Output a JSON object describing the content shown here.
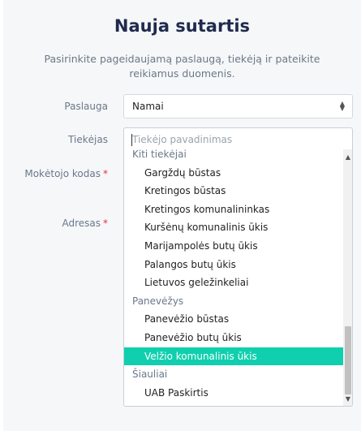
{
  "form": {
    "title": "Nauja sutartis",
    "subtitle": "Pasirinkite pageidaujamą paslaugą, tiekėją ir pateikite reikiamus duomenis.",
    "required_mark": "*",
    "fields": {
      "service_label": "Paslauga",
      "service_value": "Namai",
      "provider_label": "Tiekėjas",
      "provider_placeholder": "Tiekėjo pavadinimas",
      "payer_code_label": "Mokėtojo kodas",
      "address_label": "Adresas"
    }
  },
  "dropdown": {
    "items": [
      {
        "type": "group",
        "label": "Kiti tiekėjai"
      },
      {
        "type": "option",
        "label": "Gargždų būstas"
      },
      {
        "type": "option",
        "label": "Kretingos būstas"
      },
      {
        "type": "option",
        "label": "Kretingos komunalininkas"
      },
      {
        "type": "option",
        "label": "Kuršėnų komunalinis ūkis"
      },
      {
        "type": "option",
        "label": "Marijampolės butų ūkis"
      },
      {
        "type": "option",
        "label": "Palangos butų ūkis"
      },
      {
        "type": "option",
        "label": "Lietuvos geležinkeliai"
      },
      {
        "type": "group",
        "label": "Panevėžys"
      },
      {
        "type": "option",
        "label": "Panevėžio būstas"
      },
      {
        "type": "option",
        "label": "Panevėžio butų ūkis"
      },
      {
        "type": "option",
        "label": "Velžio komunalinis ūkis",
        "highlighted": true
      },
      {
        "type": "group",
        "label": "Šiauliai"
      },
      {
        "type": "option",
        "label": "UAB Paskirtis"
      }
    ]
  },
  "colors": {
    "title": "#1f2b4d",
    "highlight": "#10cfae",
    "required": "#e0314b"
  }
}
